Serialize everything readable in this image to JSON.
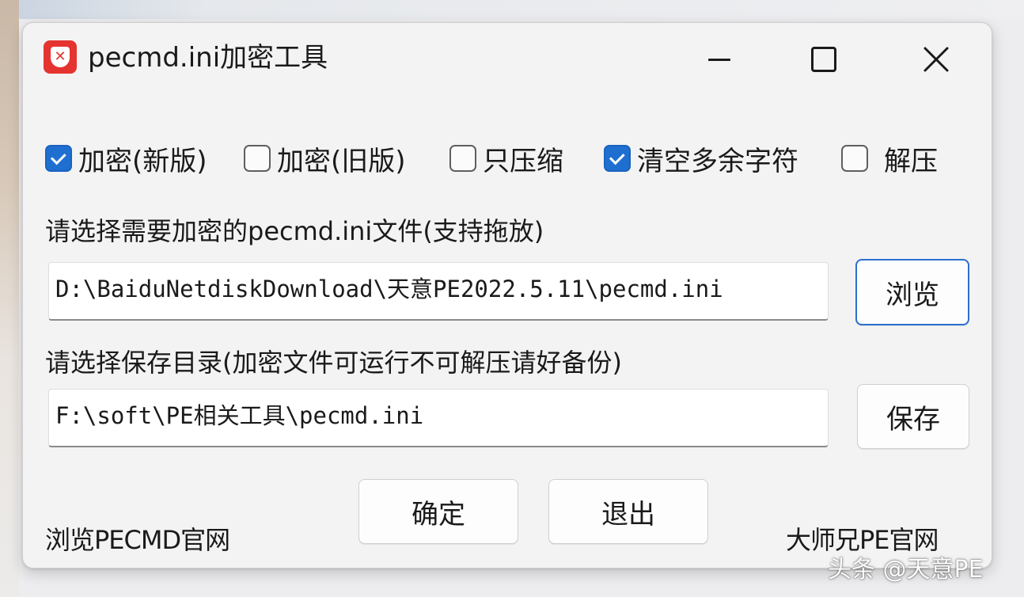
{
  "window": {
    "title": "pecmd.ini加密工具"
  },
  "icons": {
    "app": "app-shield-icon",
    "minimize": "minimize-icon",
    "maximize": "maximize-icon",
    "close": "close-icon"
  },
  "colors": {
    "accent": "#1f6fd1",
    "app_icon": "#e5342f"
  },
  "options": [
    {
      "label": "加密(新版)",
      "checked": true
    },
    {
      "label": "加密(旧版)",
      "checked": false
    },
    {
      "label": "只压缩",
      "checked": false
    },
    {
      "label": "清空多余字符",
      "checked": true
    },
    {
      "label": "解压",
      "checked": false
    }
  ],
  "source": {
    "label": "请选择需要加密的pecmd.ini文件(支持拖放)",
    "value": "D:\\BaiduNetdiskDownload\\天意PE2022.5.11\\pecmd.ini",
    "browse_label": "浏览"
  },
  "target": {
    "label": "请选择保存目录(加密文件可运行不可解压请好备份)",
    "value": "F:\\soft\\PE相关工具\\pecmd.ini",
    "save_label": "保存"
  },
  "actions": {
    "ok_label": "确定",
    "exit_label": "退出"
  },
  "footer": {
    "left_link": "浏览PECMD官网",
    "right_link": "大师兄PE官网"
  },
  "watermark": "头条 @天意PE"
}
